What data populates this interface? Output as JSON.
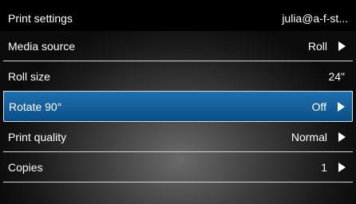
{
  "header": {
    "title": "Print settings",
    "user": "julia@a-f-st..."
  },
  "colors": {
    "selected_row": "#1760a0",
    "header_bg": "#000000",
    "text": "#ffffff"
  },
  "settings": [
    {
      "label": "Media source",
      "value": "Roll",
      "icon": "chevron-right-icon"
    },
    {
      "label": "Roll size",
      "value": "24\"",
      "icon": ""
    },
    {
      "label": "Rotate 90°",
      "value": "Off",
      "icon": "chevron-right-icon",
      "selected": true
    },
    {
      "label": "Print quality",
      "value": "Normal",
      "icon": "chevron-right-icon"
    },
    {
      "label": "Copies",
      "value": "1",
      "icon": "chevron-right-icon"
    }
  ]
}
